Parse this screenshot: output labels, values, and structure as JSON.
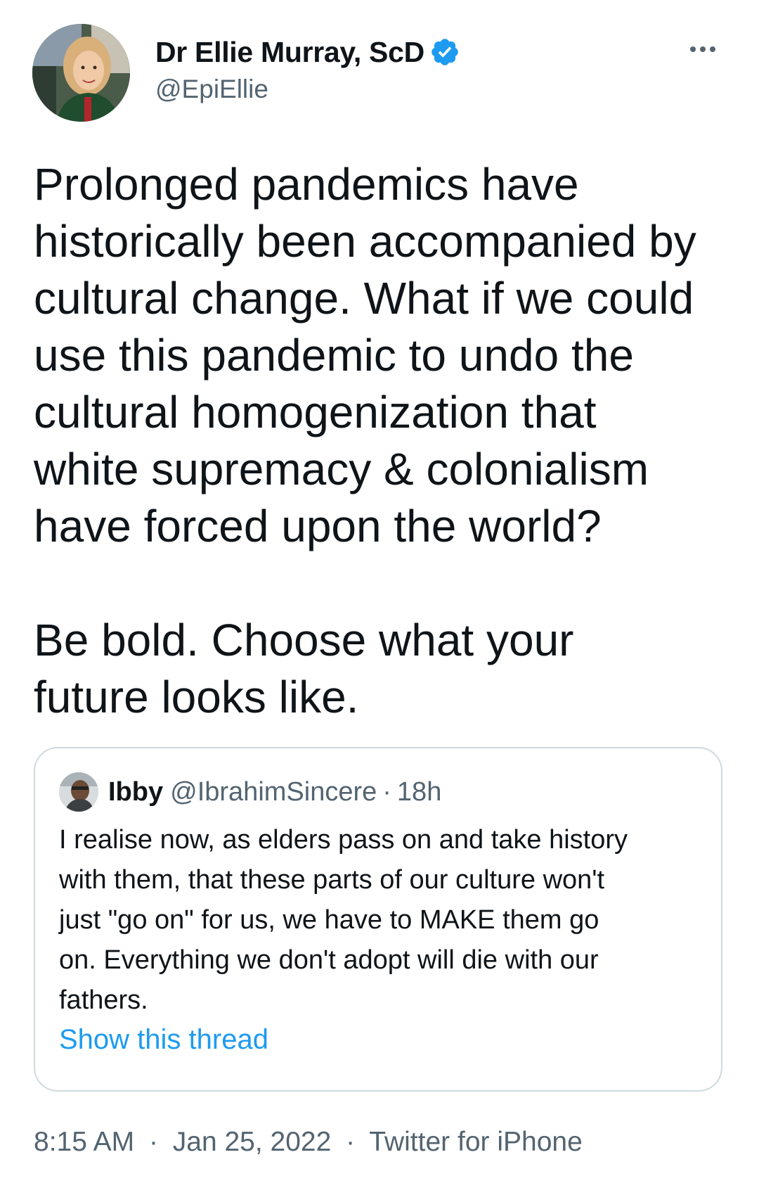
{
  "author": {
    "display_name": "Dr Ellie Murray, ScD",
    "handle": "@EpiEllie",
    "verified": true,
    "verified_color": "#1d9bf0"
  },
  "tweet": {
    "paragraph1": [
      "Prolonged pandemics have",
      "historically been accompanied by",
      "cultural change. What if we could",
      "use this pandemic to undo the",
      "cultural homogenization that",
      "white supremacy & colonialism",
      "have forced upon the world?"
    ],
    "paragraph2": [
      "Be bold. Choose what your",
      "future looks like."
    ]
  },
  "quote": {
    "display_name": "Ibby",
    "handle": "@IbrahimSincere",
    "separator": "·",
    "time": "18h",
    "lines": [
      "I realise now, as elders pass on and take history",
      "with them, that these parts of our culture won't",
      "just \"go on\" for us, we have to MAKE them go",
      "on. Everything we don't adopt will die with our",
      "fathers."
    ],
    "show_thread": "Show this thread"
  },
  "meta": {
    "time": "8:15 AM",
    "separator": "·",
    "date": "Jan 25, 2022",
    "source": "Twitter for iPhone"
  },
  "colors": {
    "text_primary": "#0f1419",
    "text_secondary": "#536471",
    "link": "#1d9bf0",
    "border": "#cfd9de"
  },
  "icons": {
    "verified": "verified-badge-icon",
    "more": "more-options-icon"
  }
}
